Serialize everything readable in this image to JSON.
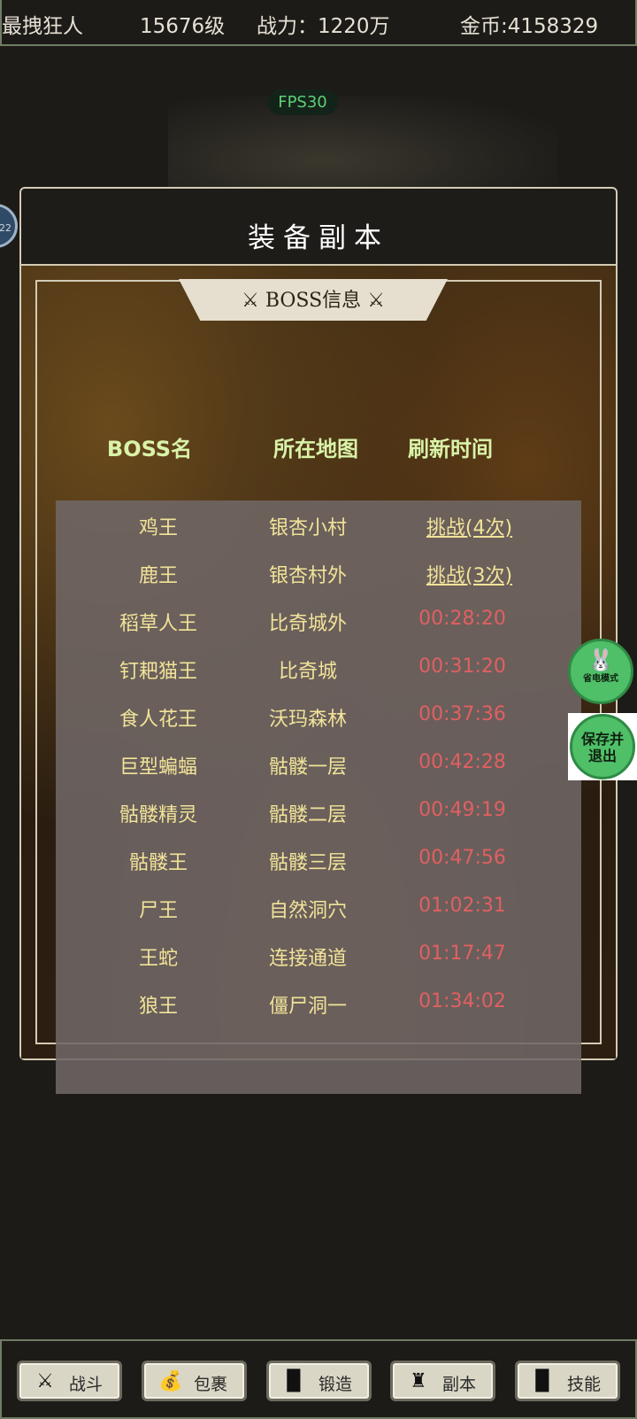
{
  "header": {
    "player_name": "最拽狂人",
    "level": "15676级",
    "power": "战力：1220万",
    "gold": "金币:4158329"
  },
  "fps": "FPS30",
  "side_badge": "22",
  "panel": {
    "title": "装备副本",
    "tab_label": "BOSS信息",
    "columns": [
      "BOSS名",
      "所在地图",
      "刷新时间"
    ],
    "bosses": [
      {
        "name": "鸡王",
        "map": "银杏小村",
        "time": "挑战(4次)"
      },
      {
        "name": "鹿王",
        "map": "银杏村外",
        "time": "挑战(3次)"
      },
      {
        "name": "稻草人王",
        "map": "比奇城外",
        "time": "00:28:20"
      },
      {
        "name": "钉耙猫王",
        "map": "比奇城",
        "time": "00:31:20"
      },
      {
        "name": "食人花王",
        "map": "沃玛森林",
        "time": "00:37:36"
      },
      {
        "name": "巨型蝙蝠",
        "map": "骷髅一层",
        "time": "00:42:28"
      },
      {
        "name": "骷髅精灵",
        "map": "骷髅二层",
        "time": "00:49:19"
      },
      {
        "name": "骷髅王",
        "map": "骷髅三层",
        "time": "00:47:56"
      },
      {
        "name": "尸王",
        "map": "自然洞穴",
        "time": "01:02:31"
      },
      {
        "name": "王蛇",
        "map": "连接通道",
        "time": "01:17:47"
      },
      {
        "name": "狼王",
        "map": "僵尸洞一",
        "time": "01:34:02"
      }
    ]
  },
  "float_buttons": {
    "power_save": "省电模式",
    "save_exit_line1": "保存并",
    "save_exit_line2": "退出"
  },
  "nav": [
    {
      "label": "战斗",
      "icon": "crossed-swords-icon"
    },
    {
      "label": "包裹",
      "icon": "bag-icon"
    },
    {
      "label": "锻造",
      "icon": "book-icon"
    },
    {
      "label": "副本",
      "icon": "tower-icon"
    },
    {
      "label": "技能",
      "icon": "skill-book-icon"
    }
  ],
  "colors": {
    "timer_red": "#e06060",
    "boss_text": "#f1e399",
    "header_green": "#d9f3a8",
    "float_green": "#4fbf68"
  }
}
